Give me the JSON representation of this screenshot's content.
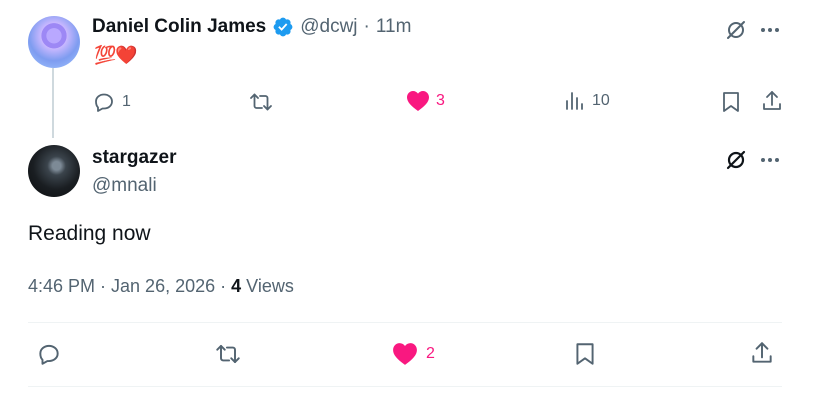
{
  "reply": {
    "author_name": "Daniel Colin James",
    "author_handle": "@dcwj",
    "separator": "·",
    "time_ago": "11m",
    "text": "💯❤️",
    "reply_count": "1",
    "like_count": "3",
    "view_count": "10"
  },
  "post": {
    "author_name": "stargazer",
    "author_handle": "@mnali",
    "text": "Reading now",
    "timestamp": "4:46 PM · Jan 26, 2026 · ",
    "views_count": "4",
    "views_label": " Views",
    "like_count": "2"
  },
  "colors": {
    "verified": "#1d9bf0",
    "like": "#f91880",
    "muted": "#536471",
    "text": "#0f1419"
  },
  "icons": [
    "verified-badge-icon",
    "grok-icon",
    "more-icon",
    "reply-icon",
    "retweet-icon",
    "heart-icon",
    "analytics-icon",
    "bookmark-icon",
    "share-icon"
  ]
}
